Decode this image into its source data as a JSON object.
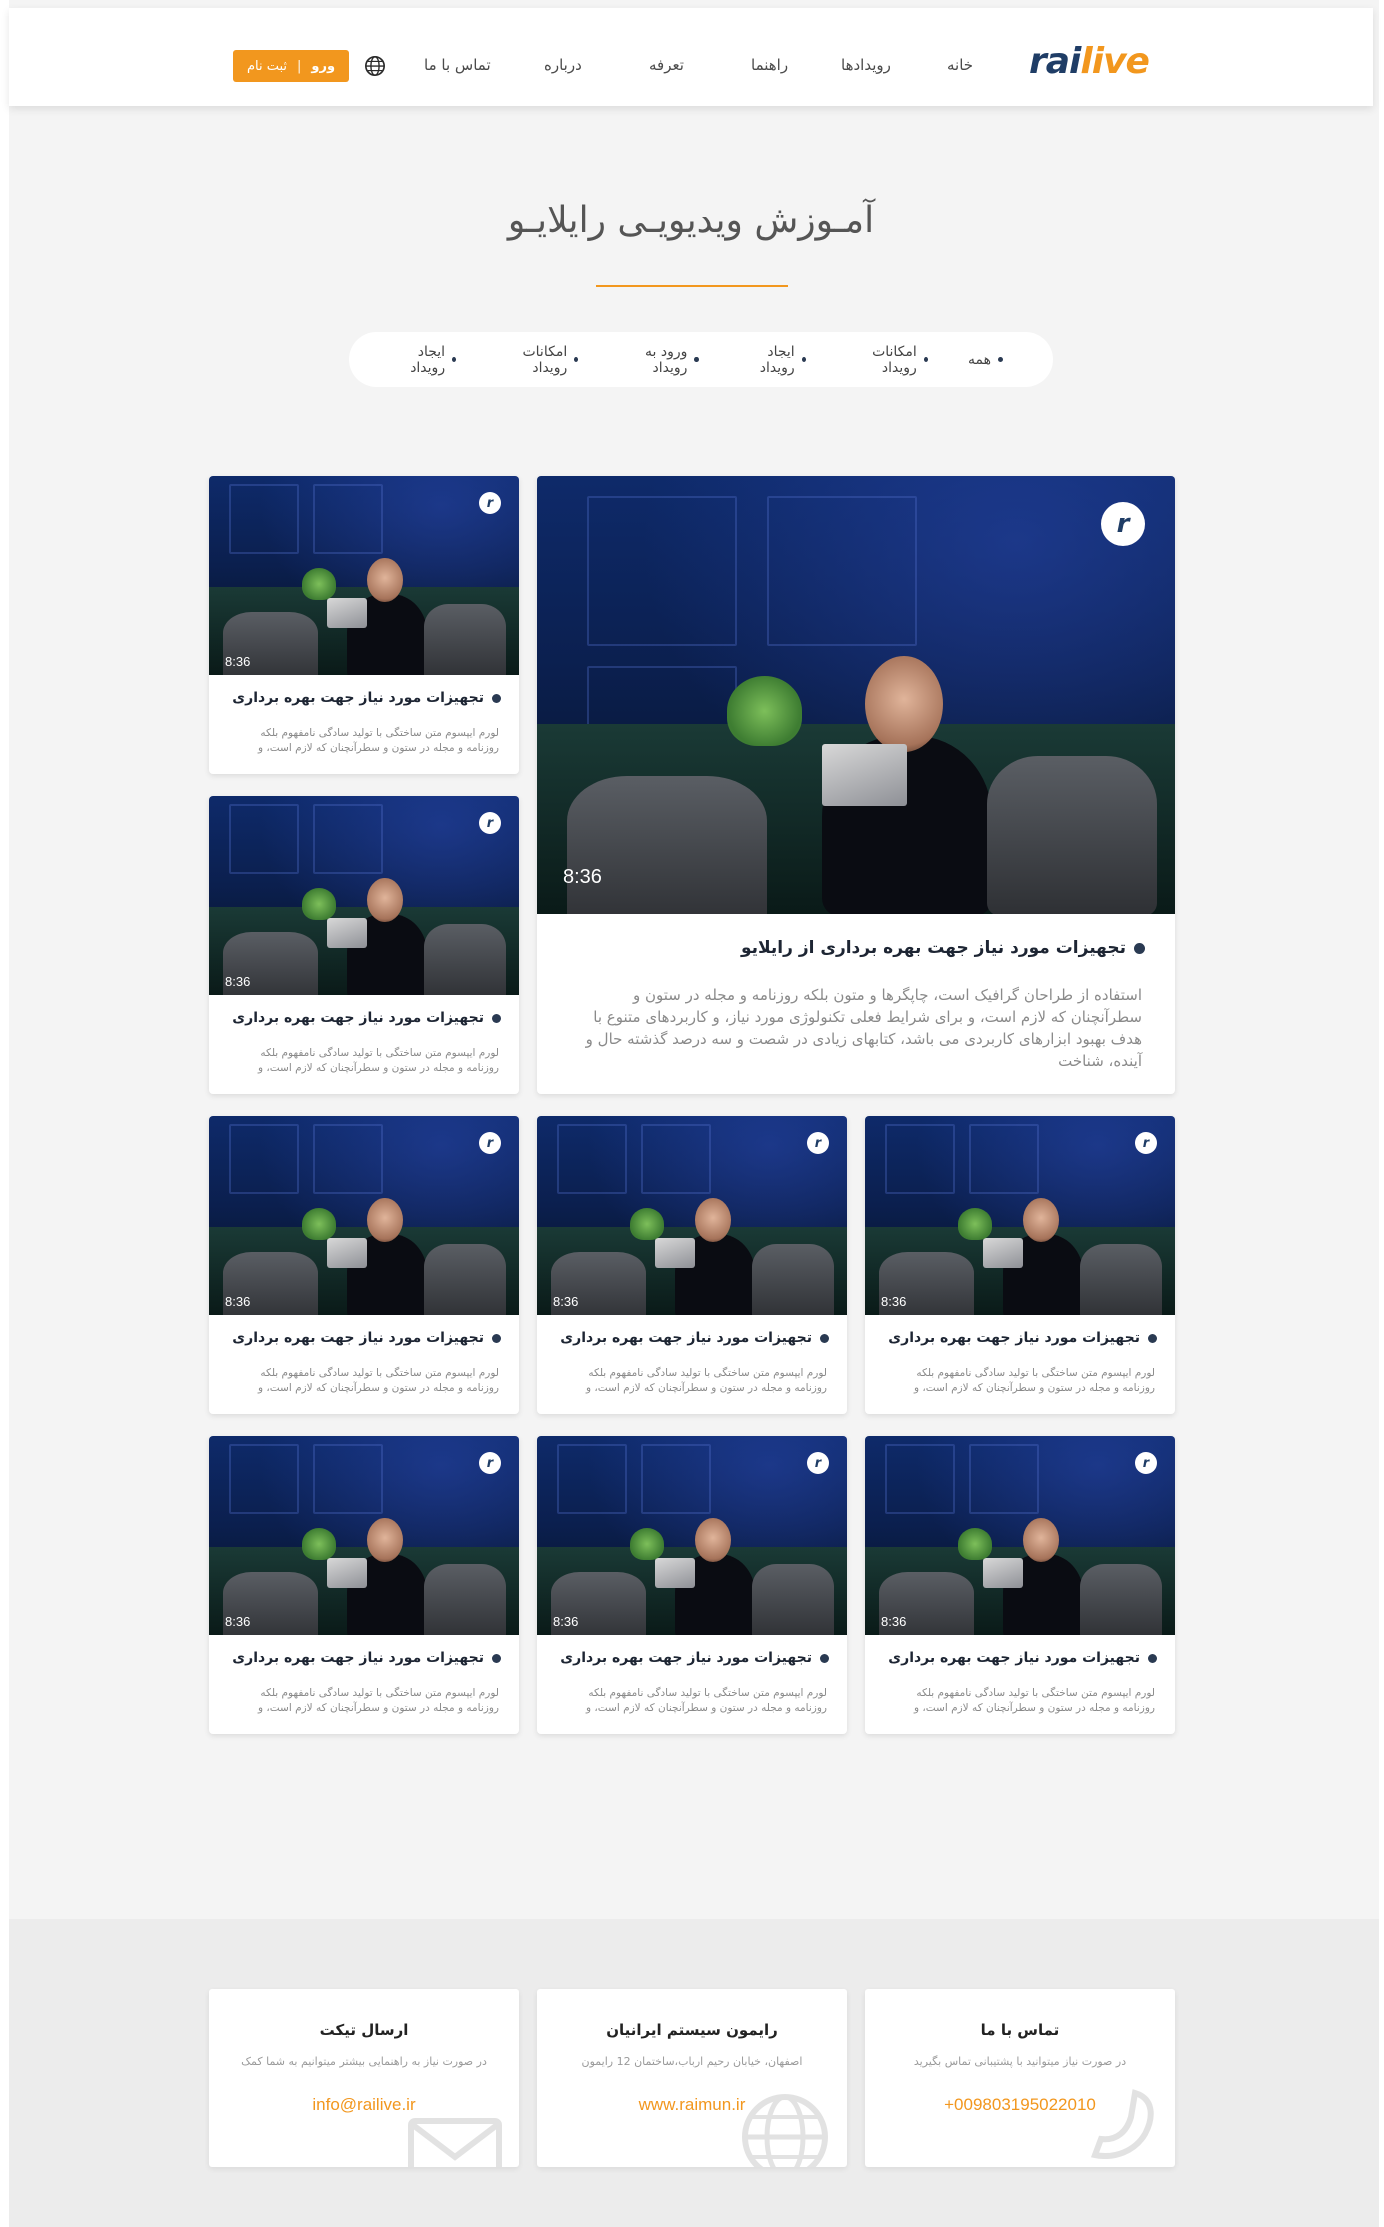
{
  "brand": {
    "logo_part1": "rai",
    "logo_part2": "live",
    "primary": "#1f3d66",
    "accent": "#f2971e"
  },
  "nav": {
    "items": [
      "خانه",
      "رویدادها",
      "راهنما",
      "تعرفه",
      "درباره",
      "تماس با ما"
    ],
    "language_icon": "globe-icon",
    "register_label": "ثبت نام",
    "separator": "|",
    "login_label": "ورو"
  },
  "page_title": "آمـوزش ویدیویـی رایلایـو",
  "filters": [
    "همه",
    "امکانات رویداد",
    "ایجاد رویداد",
    "ورود به رویداد",
    "امکانات رویداد",
    "ایجاد رویداد"
  ],
  "featured": {
    "duration": "8:36",
    "title": "تجهیزات مورد نیاز جهت بهره برداری از رایلایو",
    "description": "استفاده از طراحان گرافیک است، چاپگرها و متون بلکه روزنامه و مجله در ستون و سطرآنچنان که لازم است، و برای شرایط فعلی تکنولوژی مورد نیاز، و کاربردهای متنوع با هدف بهبود ابزارهای کاربردی می باشد، کتابهای زیادی در شصت و سه درصد گذشته حال و آینده، شناخت"
  },
  "videos": [
    {
      "duration": "8:36",
      "title": "تجهیزات مورد نیاز جهت بهره برداری",
      "description": "لورم ایپسوم متن ساختگی با تولید سادگی نامفهوم بلکه روزنامه و مجله در ستون و سطرآنچنان که لازم است، و"
    },
    {
      "duration": "8:36",
      "title": "تجهیزات مورد نیاز جهت بهره برداری",
      "description": "لورم ایپسوم متن ساختگی با تولید سادگی نامفهوم بلکه روزنامه و مجله در ستون و سطرآنچنان که لازم است، و"
    },
    {
      "duration": "8:36",
      "title": "تجهیزات مورد نیاز جهت بهره برداری",
      "description": "لورم ایپسوم متن ساختگی با تولید سادگی نامفهوم بلکه روزنامه و مجله در ستون و سطرآنچنان که لازم است، و"
    },
    {
      "duration": "8:36",
      "title": "تجهیزات مورد نیاز جهت بهره برداری",
      "description": "لورم ایپسوم متن ساختگی با تولید سادگی نامفهوم بلکه روزنامه و مجله در ستون و سطرآنچنان که لازم است، و"
    },
    {
      "duration": "8:36",
      "title": "تجهیزات مورد نیاز جهت بهره برداری",
      "description": "لورم ایپسوم متن ساختگی با تولید سادگی نامفهوم بلکه روزنامه و مجله در ستون و سطرآنچنان که لازم است، و"
    },
    {
      "duration": "8:36",
      "title": "تجهیزات مورد نیاز جهت بهره برداری",
      "description": "لورم ایپسوم متن ساختگی با تولید سادگی نامفهوم بلکه روزنامه و مجله در ستون و سطرآنچنان که لازم است، و"
    },
    {
      "duration": "8:36",
      "title": "تجهیزات مورد نیاز جهت بهره برداری",
      "description": "لورم ایپسوم متن ساختگی با تولید سادگی نامفهوم بلکه روزنامه و مجله در ستون و سطرآنچنان که لازم است، و"
    },
    {
      "duration": "8:36",
      "title": "تجهیزات مورد نیاز جهت بهره برداری",
      "description": "لورم ایپسوم متن ساختگی با تولید سادگی نامفهوم بلکه روزنامه و مجله در ستون و سطرآنچنان که لازم است، و"
    }
  ],
  "footer": {
    "cards": [
      {
        "title": "تماس با ما",
        "description": "در صورت نیاز میتوانید با پشتیبانی تماس بگیرید",
        "link": "+009803195022010",
        "icon": "phone-icon"
      },
      {
        "title": "رایمون سیستم ایرانیان",
        "description": "اصفهان، خیابان رحیم ارباب،ساختمان 12 رایمون",
        "link": "www.raimun.ir",
        "icon": "globe-icon"
      },
      {
        "title": "ارسال تیکت",
        "description": "در صورت نیاز به راهنمایی بیشتر میتوانیم به شما کمک",
        "link": "info@railive.ir",
        "icon": "envelope-icon"
      }
    ]
  }
}
